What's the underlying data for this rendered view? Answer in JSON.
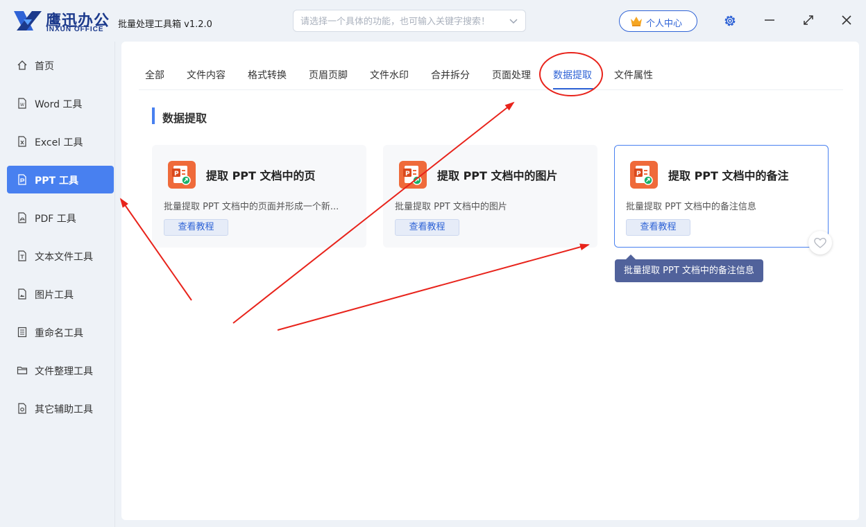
{
  "app": {
    "logo_cn": "鹰迅办公",
    "logo_en": "INXUN OFFICE",
    "title": "批量处理工具箱 v1.2.0"
  },
  "search": {
    "placeholder": "请选择一个具体的功能，也可输入关键字搜索！"
  },
  "header": {
    "personal_center": "个人中心"
  },
  "sidebar": {
    "items": [
      {
        "label": "首页",
        "icon": "home-icon"
      },
      {
        "label": "Word 工具",
        "icon": "word-file-icon"
      },
      {
        "label": "Excel 工具",
        "icon": "excel-file-icon"
      },
      {
        "label": "PPT 工具",
        "icon": "ppt-file-icon",
        "active": true
      },
      {
        "label": "PDF 工具",
        "icon": "pdf-file-icon"
      },
      {
        "label": "文本文件工具",
        "icon": "text-file-icon"
      },
      {
        "label": "图片工具",
        "icon": "image-file-icon"
      },
      {
        "label": "重命名工具",
        "icon": "rename-icon"
      },
      {
        "label": "文件整理工具",
        "icon": "folder-icon"
      },
      {
        "label": "其它辅助工具",
        "icon": "tools-icon"
      }
    ]
  },
  "tabs": [
    {
      "label": "全部"
    },
    {
      "label": "文件内容"
    },
    {
      "label": "格式转换"
    },
    {
      "label": "页眉页脚"
    },
    {
      "label": "文件水印"
    },
    {
      "label": "合并拆分"
    },
    {
      "label": "页面处理"
    },
    {
      "label": "数据提取",
      "active": true
    },
    {
      "label": "文件属性"
    }
  ],
  "section": {
    "title": "数据提取"
  },
  "cards": [
    {
      "title": "提取 PPT 文档中的页",
      "desc": "批量提取 PPT 文档中的页面并形成一个新...",
      "button": "查看教程"
    },
    {
      "title": "提取 PPT 文档中的图片",
      "desc": "批量提取 PPT 文档中的图片",
      "button": "查看教程"
    },
    {
      "title": "提取 PPT 文档中的备注",
      "desc": "批量提取 PPT 文档中的备注信息",
      "button": "查看教程",
      "hovered": true
    }
  ],
  "tooltip": {
    "text": "批量提取 PPT 文档中的备注信息"
  },
  "colors": {
    "accent": "#4880f0",
    "brand": "#1c3a8c",
    "ppt_orange": "#ef6a3a",
    "annotation_red": "#e8231b"
  }
}
